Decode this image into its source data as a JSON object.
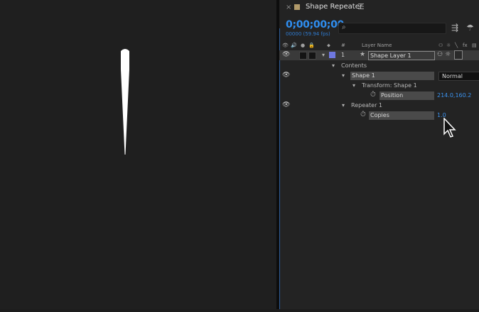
{
  "composition_title": "Shape Repeater",
  "timecode": "0;00;00;00",
  "frame_info": "00000 (59.94 fps)",
  "search_placeholder": "",
  "headers": {
    "index": "#",
    "layer_name": "Layer Name"
  },
  "layer": {
    "index": "1",
    "name": "Shape Layer 1",
    "label_color": "#6f78e0"
  },
  "tree": {
    "contents": "Contents",
    "shape": "Shape 1",
    "blend_mode": "Normal",
    "transform": "Transform: Shape 1",
    "position_label": "Position",
    "position_value": "214.0,160.2",
    "repeater": "Repeater 1",
    "copies_label": "Copies",
    "copies_value": "1.0"
  },
  "colors": {
    "accent": "#2f8ef0",
    "value": "#3b92ee",
    "panel": "#232323"
  }
}
